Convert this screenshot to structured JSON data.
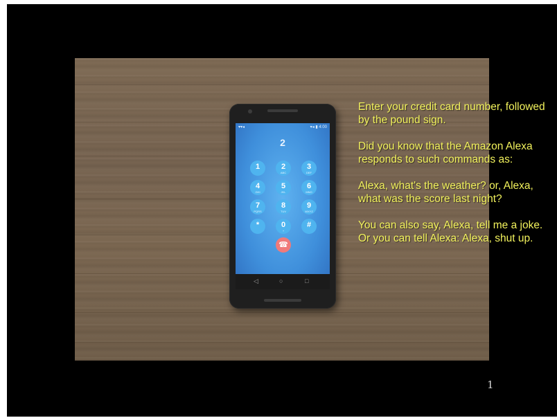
{
  "phone": {
    "status_left": "▾▾◂",
    "status_right": "▾◂ ▮ 4:00",
    "dialed_number": "2",
    "keypad": [
      {
        "digit": "1",
        "letters": ""
      },
      {
        "digit": "2",
        "letters": "ABC"
      },
      {
        "digit": "3",
        "letters": "DEF"
      },
      {
        "digit": "4",
        "letters": "GHI"
      },
      {
        "digit": "5",
        "letters": "JKL"
      },
      {
        "digit": "6",
        "letters": "MNO"
      },
      {
        "digit": "7",
        "letters": "PQRS"
      },
      {
        "digit": "8",
        "letters": "TUV"
      },
      {
        "digit": "9",
        "letters": "WXYZ"
      },
      {
        "digit": "*",
        "letters": ""
      },
      {
        "digit": "0",
        "letters": "+"
      },
      {
        "digit": "#",
        "letters": ""
      }
    ],
    "call_icon": "hang-up-icon",
    "nav": {
      "back": "◁",
      "home": "○",
      "recents": "□"
    },
    "screen_color": "#4ea1e6",
    "key_color": "#4fb4ef",
    "call_button_color": "#f07a7a"
  },
  "caption": {
    "p1": "Enter your credit card number, followed by the pound sign.",
    "p2": "Did you know that the Amazon Alexa responds to such commands as:",
    "p3": "Alexa, what's the weather? or, Alexa, what was the score last night?",
    "p4": "You can also say, Alexa, tell me a joke. Or you can tell Alexa: Alexa, shut up.",
    "color": "#f2f25c"
  },
  "page_number": "1"
}
